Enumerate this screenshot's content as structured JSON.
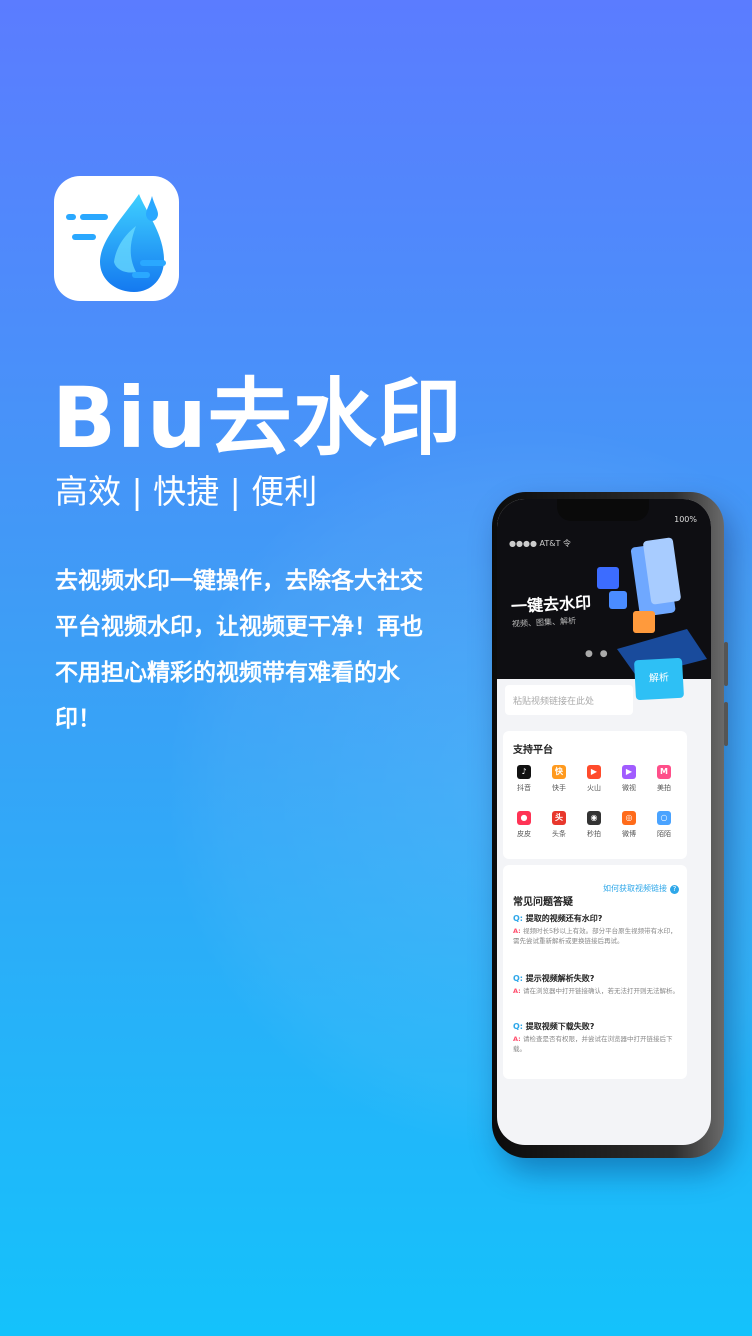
{
  "hero": {
    "title": "Biu去水印",
    "tagline": "高效 | 快捷 | 便利",
    "description": "去视频水印一键操作，去除各大社交平台视频水印，让视频更干净！再也不用担心精彩的视频带有难看的水印！"
  },
  "phone": {
    "status_left": "●●●● AT&T 令",
    "status_right": "100%",
    "banner_title": "一键去水印",
    "banner_subtitle": "视频、图集、解析",
    "search_placeholder": "粘贴视频链接在此处",
    "parse_button": "解析",
    "platforms": {
      "title": "支持平台",
      "items": [
        {
          "label": "抖音",
          "icon": "douyin-icon",
          "color": "#111111",
          "glyph": "♪"
        },
        {
          "label": "快手",
          "icon": "kuaishou-icon",
          "color": "#ff9a1e",
          "glyph": "快"
        },
        {
          "label": "火山",
          "icon": "huoshan-icon",
          "color": "#ff4b2b",
          "glyph": "▶"
        },
        {
          "label": "微视",
          "icon": "weishi-icon",
          "color": "#a15cff",
          "glyph": "▶"
        },
        {
          "label": "美拍",
          "icon": "meipai-icon",
          "color": "#ff4f8a",
          "glyph": "M"
        },
        {
          "label": "皮皮",
          "icon": "pipi-icon",
          "color": "#ff3355",
          "glyph": "●"
        },
        {
          "label": "头条",
          "icon": "toutiao-icon",
          "color": "#e8382d",
          "glyph": "头"
        },
        {
          "label": "秒拍",
          "icon": "miaopai-icon",
          "color": "#333333",
          "glyph": "◉"
        },
        {
          "label": "微博",
          "icon": "weibo-icon",
          "color": "#ff6b1a",
          "glyph": "◎"
        },
        {
          "label": "陌陌",
          "icon": "momo-icon",
          "color": "#4aa3ff",
          "glyph": "○"
        }
      ]
    },
    "faq": {
      "title": "常见问题答疑",
      "help_link": "如何获取视频链接",
      "items": [
        {
          "q": "提取的视频还有水印?",
          "a": "视频时长5秒以上有效。部分平台原生视频带有水印，需先尝试重新解析或更换链接后再试。"
        },
        {
          "q": "提示视频解析失败?",
          "a": "请在浏览器中打开链接确认，若无法打开则无法解析。"
        },
        {
          "q": "提取视频下载失败?",
          "a": "请检查是否有权限，并尝试在浏览器中打开链接后下载。"
        }
      ]
    }
  }
}
